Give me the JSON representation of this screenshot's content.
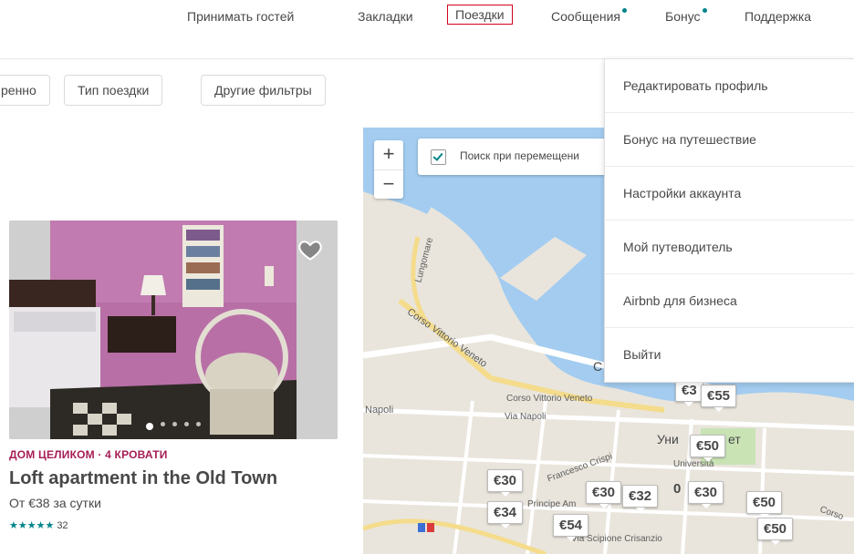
{
  "nav": {
    "host": "Принимать гостей",
    "saved": "Закладки",
    "trips": "Поездки",
    "messages": "Сообщения",
    "bonus": "Бонус",
    "support": "Поддержка"
  },
  "filters": {
    "partial": "ренно",
    "trip_type": "Тип поездки",
    "more_filters": "Другие фильтры"
  },
  "listing": {
    "type": "ДОМ ЦЕЛИКОМ · 4 КРОВАТИ",
    "title": "Loft apartment in the Old Town",
    "price": "От €38 за сутки",
    "stars": "★★★★★",
    "reviews": "32"
  },
  "map": {
    "zoom_in": "+",
    "zoom_out": "−",
    "search_as_move": "Поиск при перемещени",
    "labels": {
      "lungomare": "Lungomare",
      "corso_vittorio_1": "Corso Vittorio Veneto",
      "corso_vittorio_2": "Corso Vittorio Veneto",
      "via_napoli": "Via Napoli",
      "napoli": "Napoli",
      "universita": "Università",
      "via_scipione": "Via Scipione Crisanzio",
      "prospect": "Principe Am",
      "francesco": "Francesco Crispi",
      "corso": "Corso"
    },
    "prices": [
      "€3",
      "€55",
      "€50",
      "€30",
      "€30",
      "€32",
      "€30",
      "€50",
      "€34",
      "€54",
      "€50"
    ],
    "partial_labels": {
      "uni": "Уни",
      "et": "ет",
      "c": "C",
      "zero": "0"
    }
  },
  "dropdown": {
    "items": [
      "Редактировать профиль",
      "Бонус на путешествие",
      "Настройки аккаунта",
      "Мой путеводитель",
      "Airbnb для бизнеса",
      "Выйти"
    ]
  },
  "colors": {
    "accent_teal": "#008489",
    "brand_pink": "#a61d55",
    "active_outline": "#d0021b",
    "sea": "#a3ccf0"
  }
}
